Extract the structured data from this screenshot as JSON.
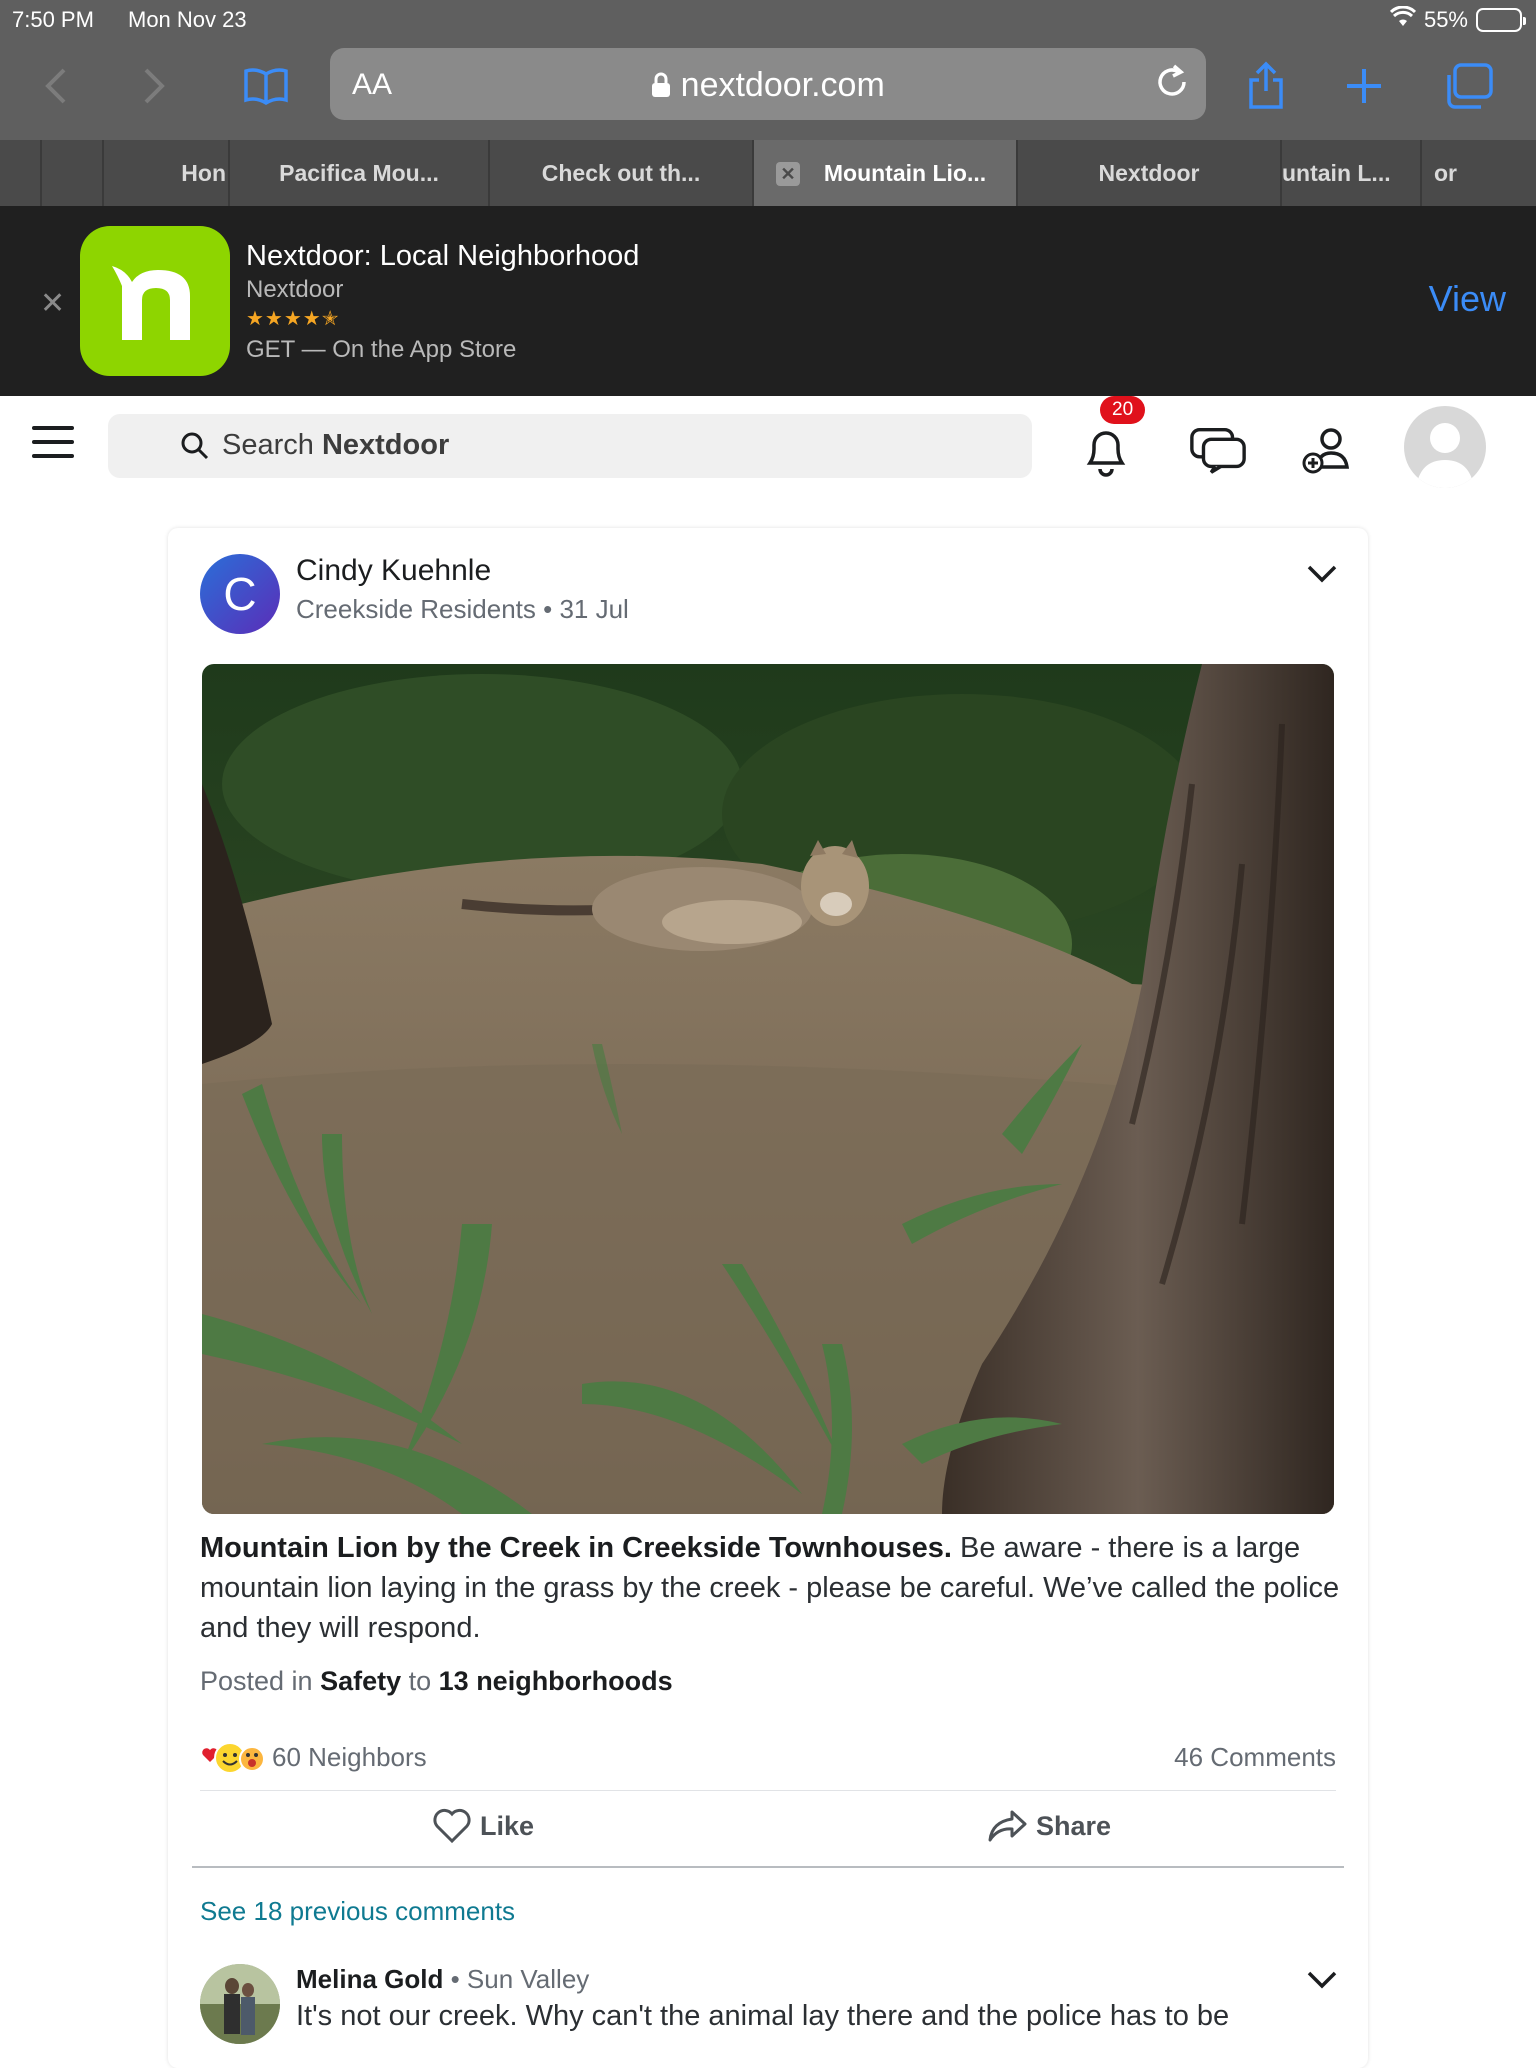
{
  "status_bar": {
    "time": "7:50 PM",
    "date": "Mon Nov 23",
    "battery": "55%",
    "battery_level": 0.55
  },
  "browser": {
    "url": "nextdoor.com",
    "aa_label": "AA",
    "tabs": [
      {
        "label": ""
      },
      {
        "label": "Hon"
      },
      {
        "label": "Pacifica Mou..."
      },
      {
        "label": "Check out th..."
      },
      {
        "label": "Mountain Lio..."
      },
      {
        "label": "Nextdoor"
      },
      {
        "label": "untain L..."
      },
      {
        "label": "or"
      }
    ],
    "active_tab": "Mountain Lio..."
  },
  "app_banner": {
    "title": "Nextdoor: Local Neighborhood",
    "developer": "Nextdoor",
    "stars": "★★★★✭",
    "rating": 4.5,
    "get_text": "GET — On the App Store",
    "view_label": "View",
    "logo_color": "#8ed500"
  },
  "header": {
    "search_placeholder_prefix": "Search ",
    "search_placeholder_brand": "Nextdoor",
    "notification_count": "20"
  },
  "post": {
    "author_initial": "C",
    "author": "Cindy Kuehnle",
    "neighborhood": "Creekside Residents",
    "date": "31 Jul",
    "title": "Mountain Lion by the Creek in  Creekside Townhouses.",
    "body": " Be aware - there is a large mountain lion laying in the grass by the creek - please be careful. We’ve called the police and they will respond.",
    "posted_in_prefix": "Posted in ",
    "category": "Safety",
    "posted_to": " to ",
    "audience": "13 neighborhoods",
    "reaction_count": "60 Neighbors",
    "comment_count": "46 Comments",
    "like_label": "Like",
    "share_label": "Share"
  },
  "comments": {
    "see_previous": "See 18 previous comments",
    "items": [
      {
        "author": "Melina Gold",
        "neighborhood": "Sun Valley",
        "text": "It's not our creek. Why can't the animal lay there and the police has to be"
      }
    ]
  },
  "colors": {
    "nextdoor_green": "#8ed500",
    "link_blue": "#3b8cf7",
    "teal_link": "#0f7a91",
    "badge_red": "#e0111b"
  }
}
